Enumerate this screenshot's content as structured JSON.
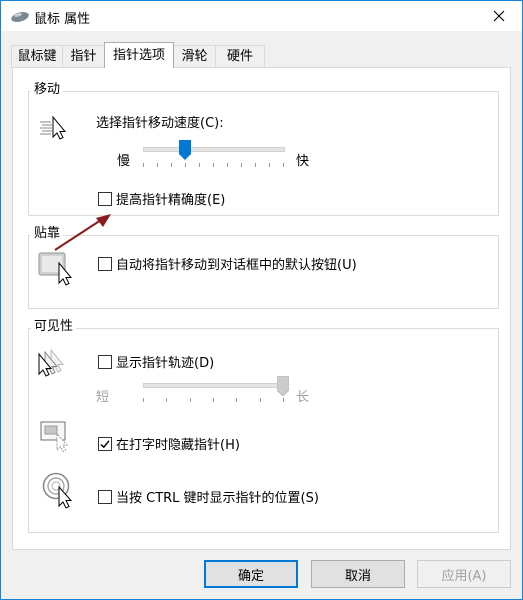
{
  "window": {
    "title": "鼠标 属性"
  },
  "tabs": [
    {
      "label": "鼠标键",
      "active": false
    },
    {
      "label": "指针",
      "active": false
    },
    {
      "label": "指针选项",
      "active": true
    },
    {
      "label": "滑轮",
      "active": false
    },
    {
      "label": "硬件",
      "active": false
    }
  ],
  "motion": {
    "group_label": "移动",
    "speed_label": "选择指针移动速度(C):",
    "slow_label": "慢",
    "fast_label": "快",
    "speed_value": 6,
    "speed_max": 20,
    "precision_label": "提高指针精确度(E)",
    "precision_checked": false
  },
  "snap": {
    "group_label": "贴靠",
    "snap_label": "自动将指针移动到对话框中的默认按钮(U)",
    "snap_checked": false
  },
  "visibility": {
    "group_label": "可见性",
    "trails_label": "显示指针轨迹(D)",
    "trails_checked": false,
    "short_label": "短",
    "long_label": "长",
    "trail_value": 1.0,
    "hide_label": "在打字时隐藏指针(H)",
    "hide_checked": true,
    "ctrl_label": "当按 CTRL 键时显示指针的位置(S)",
    "ctrl_checked": false
  },
  "buttons": {
    "ok": "确定",
    "cancel": "取消",
    "apply": "应用(A)"
  },
  "colors": {
    "accent": "#0078d7",
    "arrow": "#8b1a1a"
  }
}
